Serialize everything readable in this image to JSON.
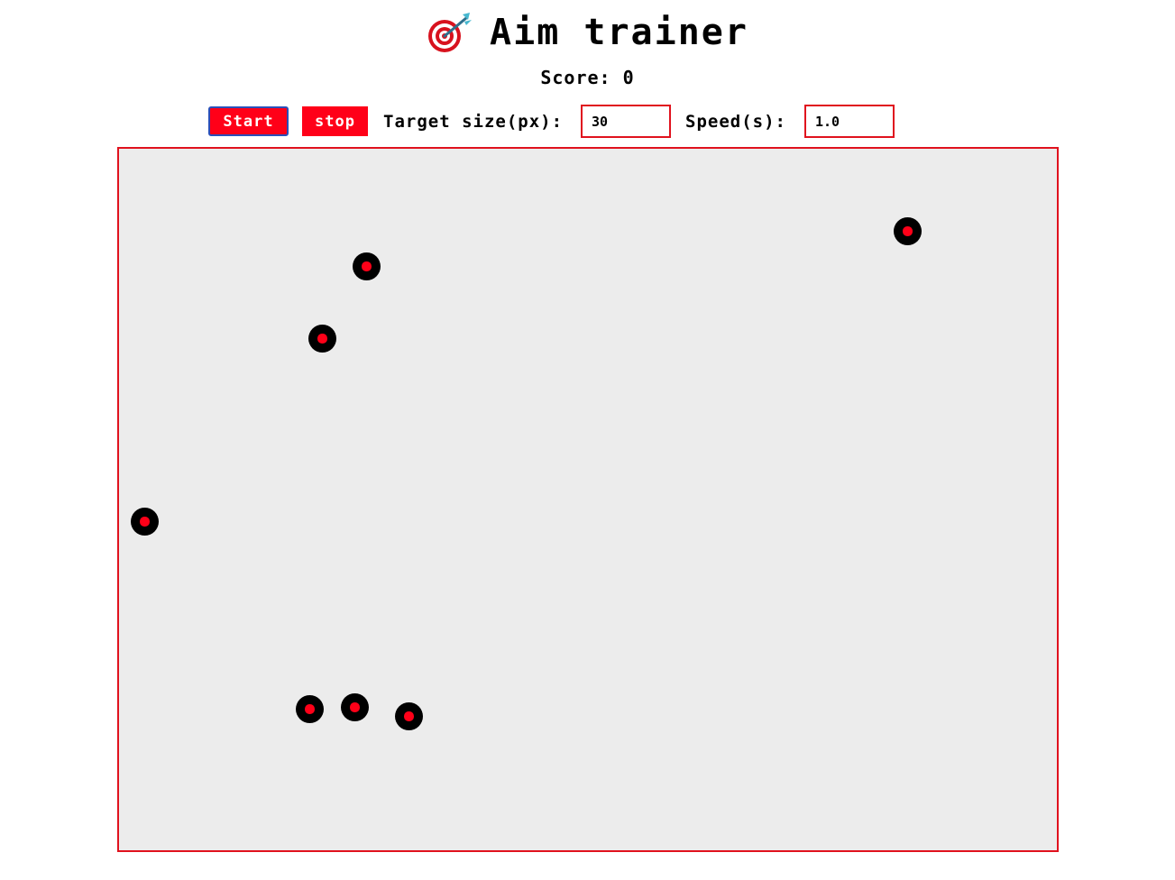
{
  "app": {
    "title": "Aim trainer",
    "title_icon": "dart-target-icon"
  },
  "score": {
    "label": "Score:",
    "value": "0"
  },
  "controls": {
    "start_label": "Start",
    "stop_label": "stop",
    "size_label": "Target size(px):",
    "size_value": "30",
    "speed_label": "Speed(s):",
    "speed_value": "1.0"
  },
  "colors": {
    "accent": "#ff0018",
    "border": "#e0121e",
    "arena_bg": "#ececec",
    "target": "#000000",
    "start_outline": "#2a4fb8"
  },
  "targets": [
    {
      "id": "target-1",
      "icon": "target-icon"
    },
    {
      "id": "target-2",
      "icon": "target-icon"
    },
    {
      "id": "target-3",
      "icon": "target-icon"
    },
    {
      "id": "target-4",
      "icon": "target-icon"
    },
    {
      "id": "target-5",
      "icon": "target-icon"
    },
    {
      "id": "target-6",
      "icon": "target-icon"
    },
    {
      "id": "target-7",
      "icon": "target-icon"
    }
  ]
}
